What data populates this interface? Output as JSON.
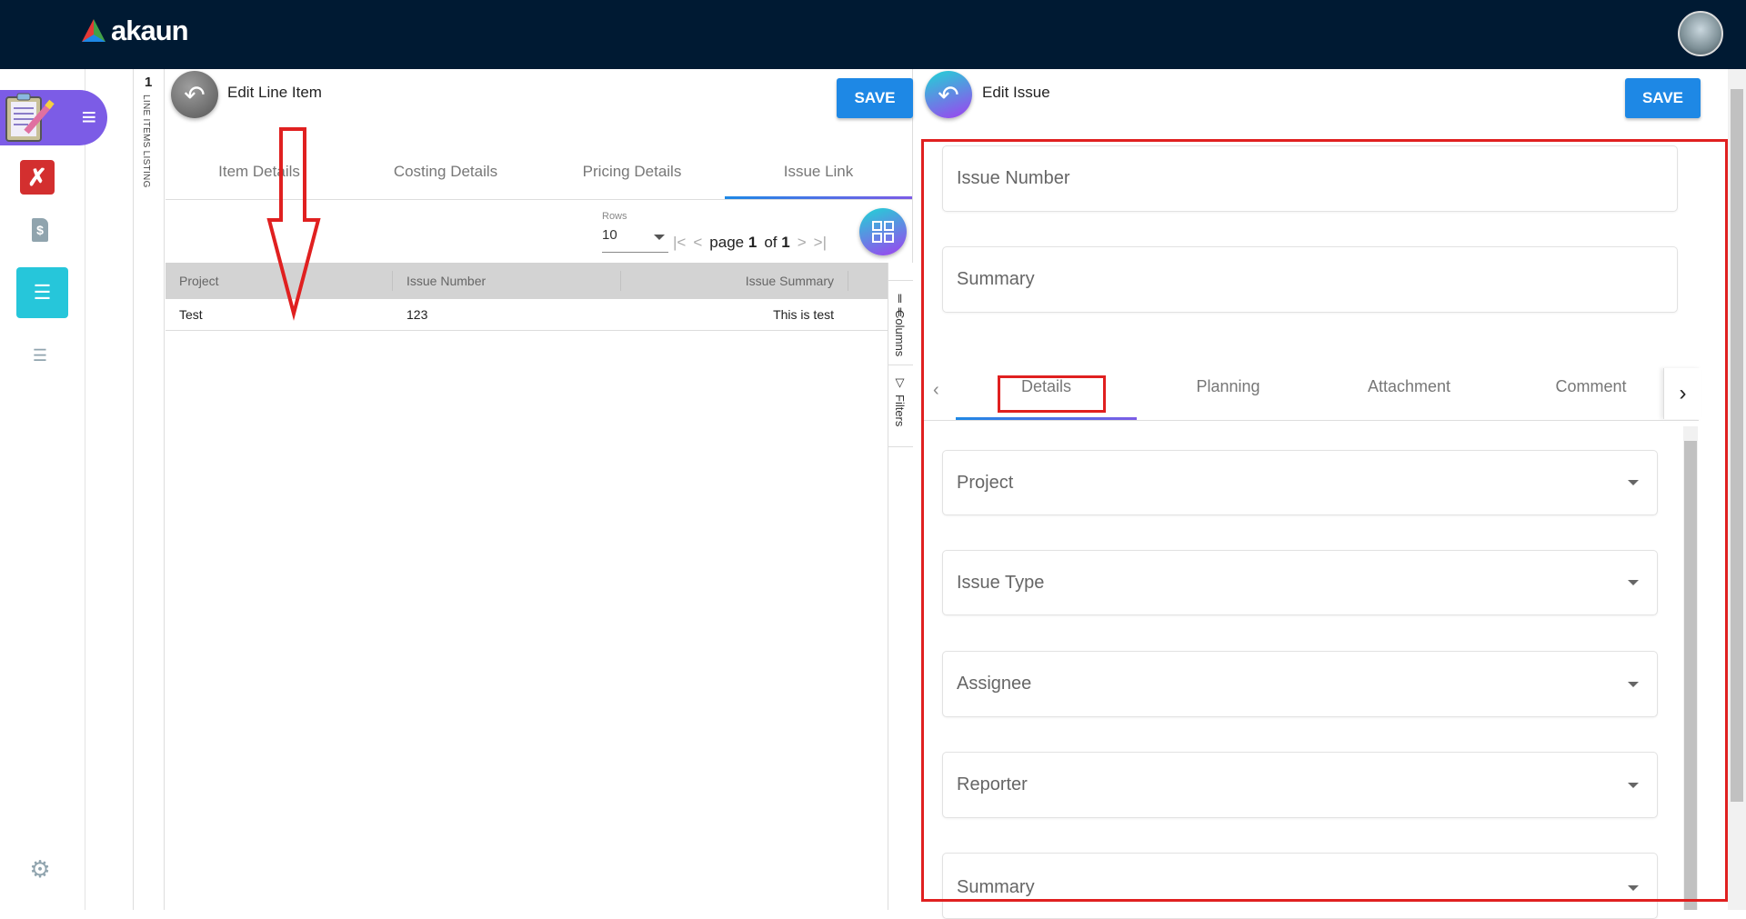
{
  "app": {
    "brand": "akaun"
  },
  "sidebar": {
    "items": [
      "clipboard-app",
      "acrobat",
      "invoice",
      "line-items-list",
      "list",
      "settings"
    ]
  },
  "strip": {
    "count": "1",
    "label": "LINE ITEMS LISTING"
  },
  "left_panel": {
    "title": "Edit Line Item",
    "save_label": "SAVE",
    "tabs": [
      {
        "label": "Item Details"
      },
      {
        "label": "Costing Details"
      },
      {
        "label": "Pricing Details"
      },
      {
        "label": "Issue Link",
        "active": true
      }
    ],
    "rows_label": "Rows",
    "rows_value": "10",
    "pagination": {
      "prefix": "page",
      "current": "1",
      "of": "of",
      "total": "1"
    },
    "table": {
      "columns": [
        "Project",
        "Issue Number",
        "Issue Summary"
      ],
      "rows": [
        {
          "project": "Test",
          "issue_number": "123",
          "issue_summary": "This is test"
        }
      ]
    },
    "side_tools": {
      "columns": "Columns",
      "filters": "Filters"
    }
  },
  "right_panel": {
    "title": "Edit Issue",
    "save_label": "SAVE",
    "fields": {
      "issue_number": "Issue Number",
      "summary": "Summary"
    },
    "tabs": [
      {
        "label": "Details",
        "active": true
      },
      {
        "label": "Planning"
      },
      {
        "label": "Attachment"
      },
      {
        "label": "Comment"
      }
    ],
    "dropdowns": [
      "Project",
      "Issue Type",
      "Assignee",
      "Reporter",
      "Summary"
    ]
  },
  "colors": {
    "topbar": "#001a33",
    "accent": "#1e88e5",
    "annotation": "#e02020",
    "active_sidebar": "#26c6da"
  }
}
